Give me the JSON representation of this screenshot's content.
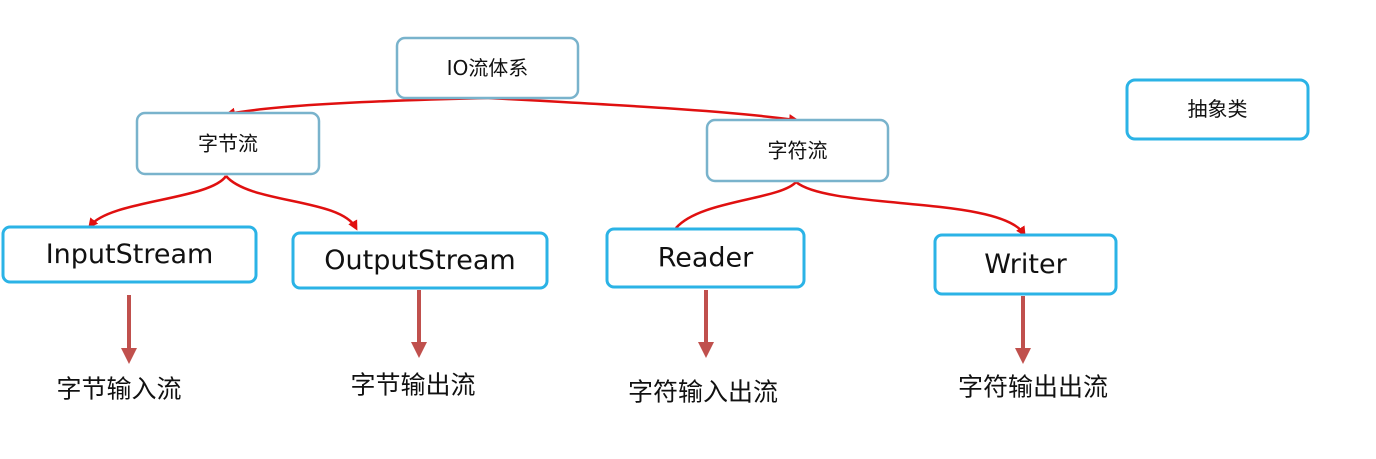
{
  "diagram": {
    "root": {
      "label": "IO流体系"
    },
    "legend": {
      "label": "抽象类"
    },
    "branches": [
      {
        "label": "字节流",
        "children": [
          {
            "label": "InputStream",
            "caption": "字节输入流"
          },
          {
            "label": "OutputStream",
            "caption": "字节输出流"
          }
        ]
      },
      {
        "label": "字符流",
        "children": [
          {
            "label": "Reader",
            "caption": "字符输入出流"
          },
          {
            "label": "Writer",
            "caption": "字符输出出流"
          }
        ]
      }
    ],
    "colors": {
      "box_border": "#2bb3e6",
      "box_border_light": "#79b3cc",
      "tree_edge": "#e01010",
      "down_arrow": "#c0504d"
    }
  }
}
